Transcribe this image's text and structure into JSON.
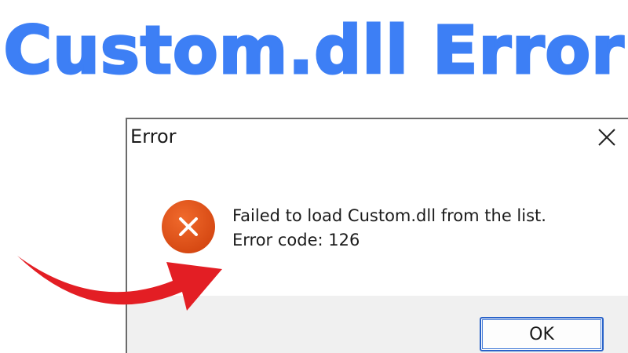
{
  "banner": {
    "title": "Custom.dll Error"
  },
  "dialog": {
    "title": "Error",
    "message_line_1": "Failed to load Custom.dll from the list.",
    "message_line_2": "Error code: 126",
    "ok_label": "OK",
    "icon": "error-x-icon",
    "close_icon": "close-icon"
  },
  "decoration": {
    "arrow_icon": "red-curved-arrow-icon"
  },
  "colors": {
    "headline": "#3d7ff5",
    "error_icon": "#e2541c",
    "arrow": "#e31e24",
    "button_border": "#2a63c9",
    "footer_bg": "#f0f0f0"
  }
}
